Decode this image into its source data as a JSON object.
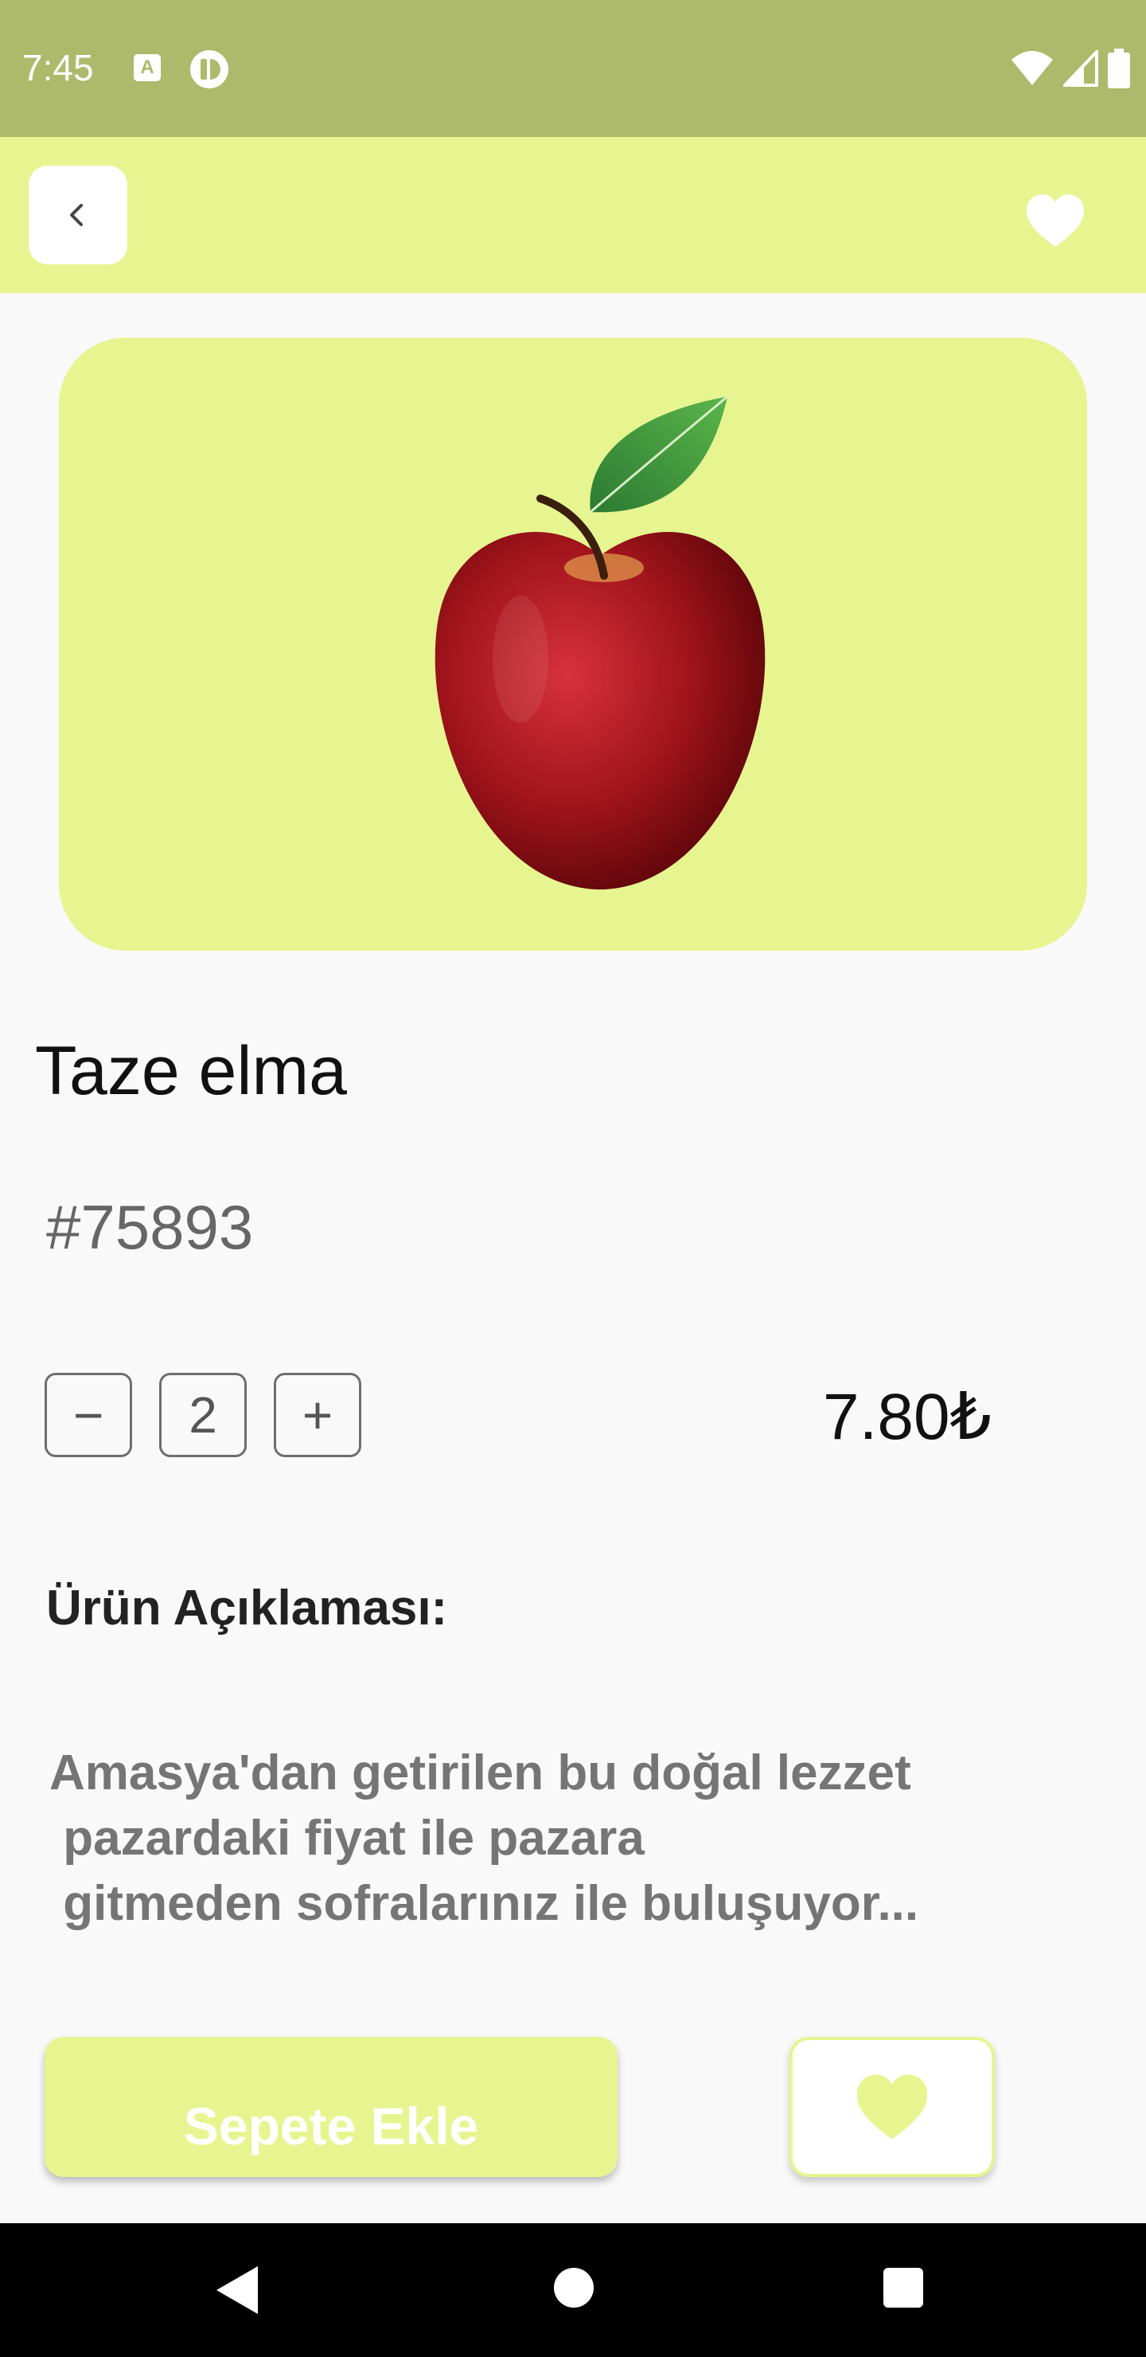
{
  "status_bar": {
    "time": "7:45",
    "icon_a_letter": "A"
  },
  "top_bar": {
    "back_icon": "chevron-left-icon",
    "favorite_icon": "heart-icon"
  },
  "product": {
    "title": "Taze elma",
    "code": "#75893",
    "quantity": "2",
    "minus_label": "−",
    "plus_label": "+",
    "price": "7.80₺",
    "image_icon": "apple-image"
  },
  "description": {
    "heading": "Ürün Açıklaması:",
    "body": "Amasya'dan getirilen bu doğal lezzet\n pazardaki fiyat ile pazara\n gitmeden sofralarınız ile buluşuyor..."
  },
  "actions": {
    "add_to_cart_label": "Sepete Ekle"
  },
  "colors": {
    "status_bar": "#adb96b",
    "accent": "#e6f58f",
    "background": "#f9f9f9"
  }
}
